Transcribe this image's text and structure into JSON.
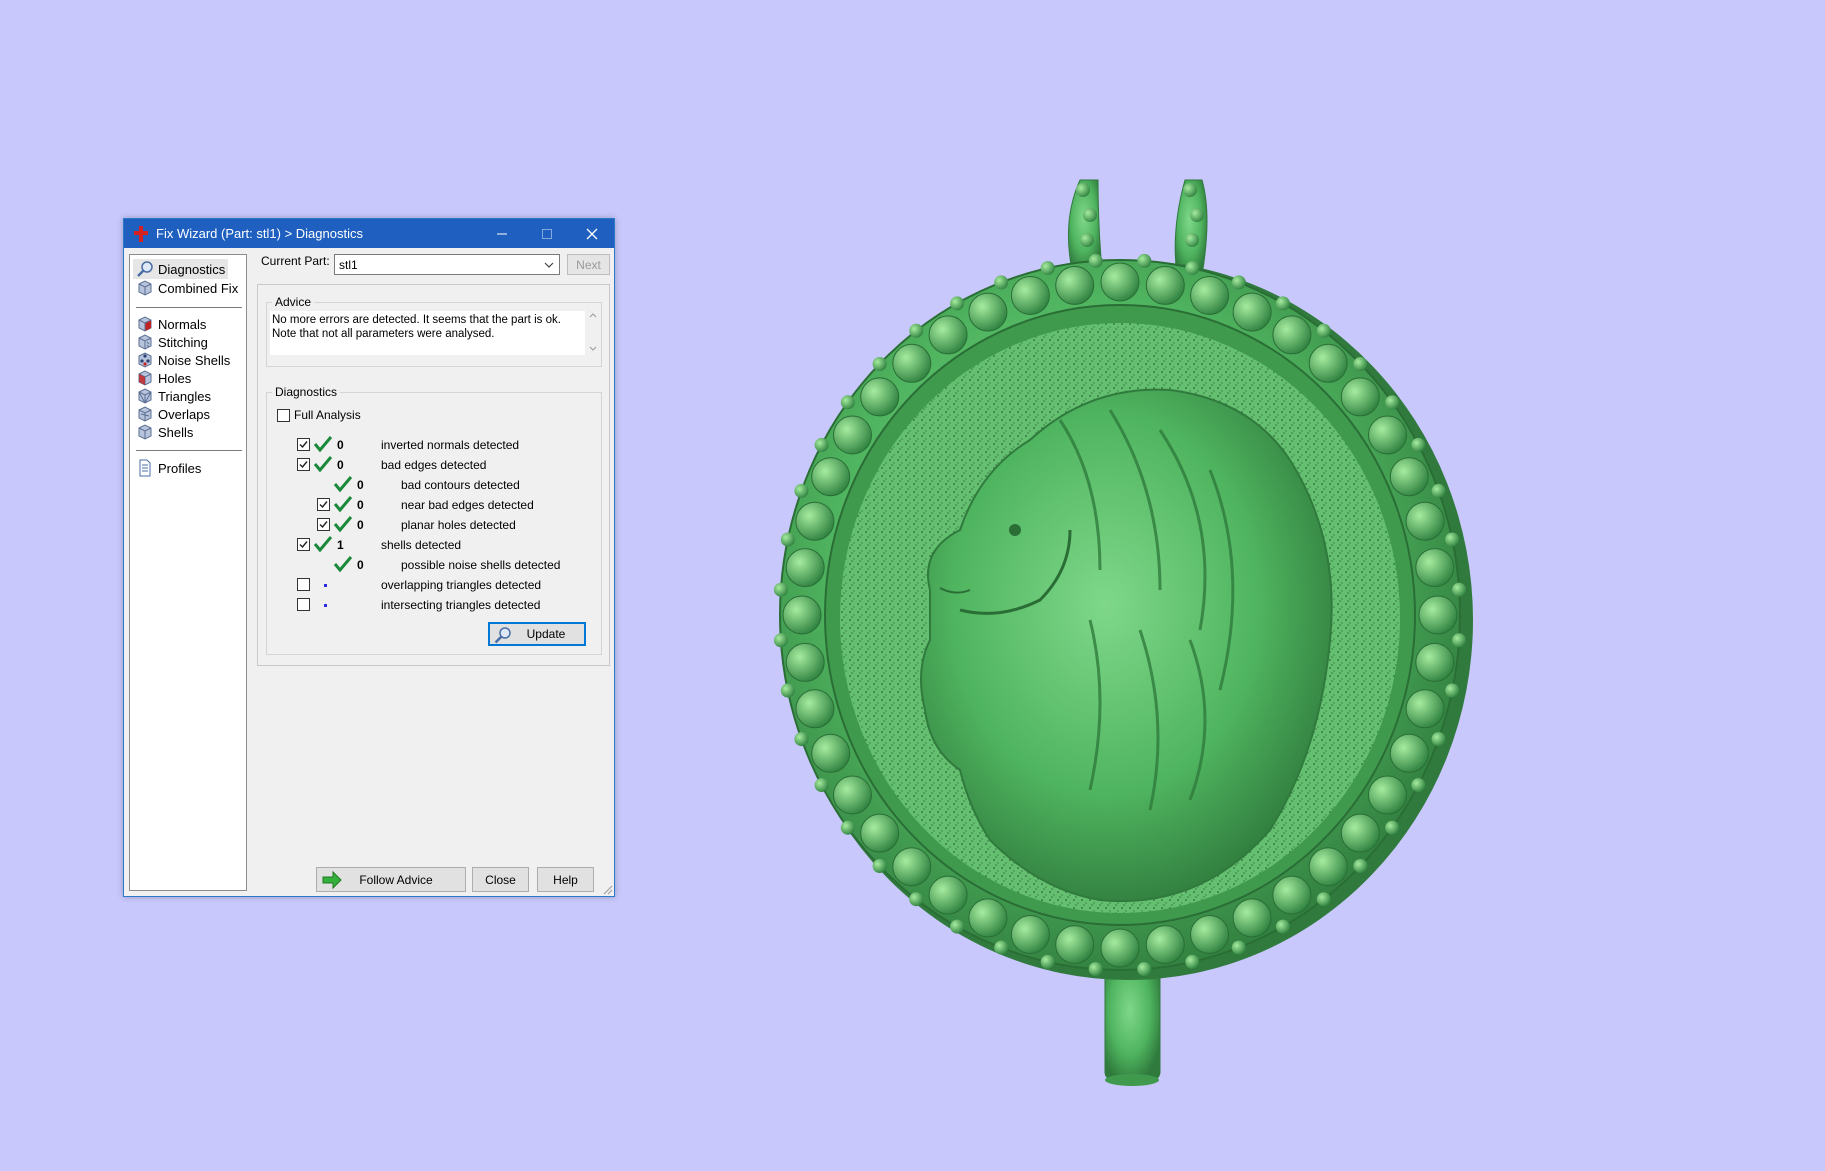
{
  "window": {
    "title": "Fix Wizard (Part: stl1) > Diagnostics",
    "controls": [
      "minimize-icon",
      "maximize-icon",
      "close-icon"
    ]
  },
  "sidebar": {
    "items": [
      {
        "label": "Diagnostics",
        "icon": "magnifier-icon",
        "selected": true
      },
      {
        "label": "Combined Fix",
        "icon": "cube-icon"
      },
      {
        "label": "Normals",
        "icon": "normals-cube-icon"
      },
      {
        "label": "Stitching",
        "icon": "stitching-cube-icon"
      },
      {
        "label": "Noise Shells",
        "icon": "noise-shells-icon"
      },
      {
        "label": "Holes",
        "icon": "holes-cube-icon"
      },
      {
        "label": "Triangles",
        "icon": "triangles-cube-icon"
      },
      {
        "label": "Overlaps",
        "icon": "overlaps-cube-icon"
      },
      {
        "label": "Shells",
        "icon": "shells-cube-icon"
      },
      {
        "label": "Profiles",
        "icon": "document-icon"
      }
    ]
  },
  "current_part": {
    "label": "Current Part:",
    "value": "stl1",
    "next_label": "Next"
  },
  "advice": {
    "legend": "Advice",
    "line1": "No more errors are detected. It seems that the part is ok.",
    "line2": "Note that not all parameters were analysed."
  },
  "diagnostics": {
    "legend": "Diagnostics",
    "full_analysis_label": "Full Analysis",
    "full_analysis_checked": false,
    "rows": [
      {
        "label": "inverted normals detected",
        "count": "0",
        "checked": true,
        "has_checkbox": true,
        "ok": true
      },
      {
        "label": "bad edges detected",
        "count": "0",
        "checked": true,
        "has_checkbox": true,
        "ok": true
      },
      {
        "label": "bad contours detected",
        "count": "0",
        "has_checkbox": false,
        "ok": true
      },
      {
        "label": "near bad edges detected",
        "count": "0",
        "checked": true,
        "has_checkbox": true,
        "ok": true
      },
      {
        "label": "planar holes detected",
        "count": "0",
        "checked": true,
        "has_checkbox": true,
        "ok": true
      },
      {
        "label": "shells detected",
        "count": "1",
        "checked": true,
        "has_checkbox": true,
        "ok": true
      },
      {
        "label": "possible noise shells detected",
        "count": "0",
        "has_checkbox": false,
        "ok": true
      },
      {
        "label": "overlapping triangles detected",
        "count": "",
        "checked": false,
        "has_checkbox": true,
        "ok": false
      },
      {
        "label": "intersecting triangles detected",
        "count": "",
        "checked": false,
        "has_checkbox": true,
        "ok": false
      }
    ],
    "update_label": "Update"
  },
  "footer": {
    "follow_advice_label": "Follow Advice",
    "close_label": "Close",
    "help_label": "Help"
  },
  "colors": {
    "background": "#c8c8fc",
    "titlebar": "#1f5fbf",
    "check_green": "#1a8a3a",
    "model_green": "#4caf5c"
  }
}
